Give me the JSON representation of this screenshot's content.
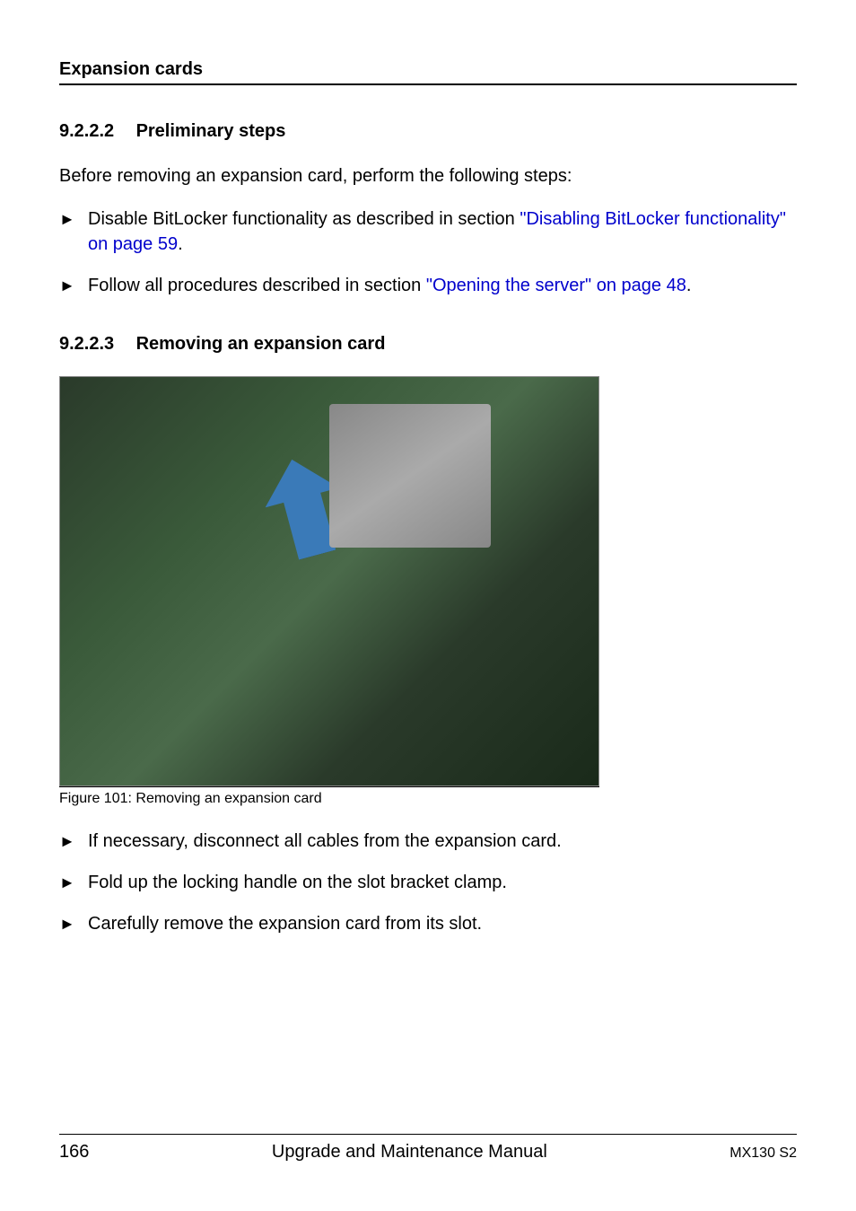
{
  "header": {
    "title": "Expansion cards"
  },
  "section1": {
    "number": "9.2.2.2",
    "title": "Preliminary steps",
    "intro": "Before removing an expansion card, perform the following steps:",
    "items": [
      {
        "prefix": "Disable BitLocker functionality as described in section ",
        "link": "\"Disabling BitLocker functionality\" on page 59",
        "suffix": "."
      },
      {
        "prefix": "Follow all procedures described in section ",
        "link": "\"Opening the server\" on page 48",
        "suffix": "."
      }
    ]
  },
  "section2": {
    "number": "9.2.2.3",
    "title": "Removing an expansion card",
    "figure_caption": "Figure 101: Removing an expansion card",
    "items": [
      "If necessary, disconnect all cables from the expansion card.",
      "Fold up the locking handle on the slot bracket clamp.",
      "Carefully remove the expansion card from its slot."
    ]
  },
  "footer": {
    "page": "166",
    "title": "Upgrade and Maintenance Manual",
    "model": "MX130 S2"
  }
}
